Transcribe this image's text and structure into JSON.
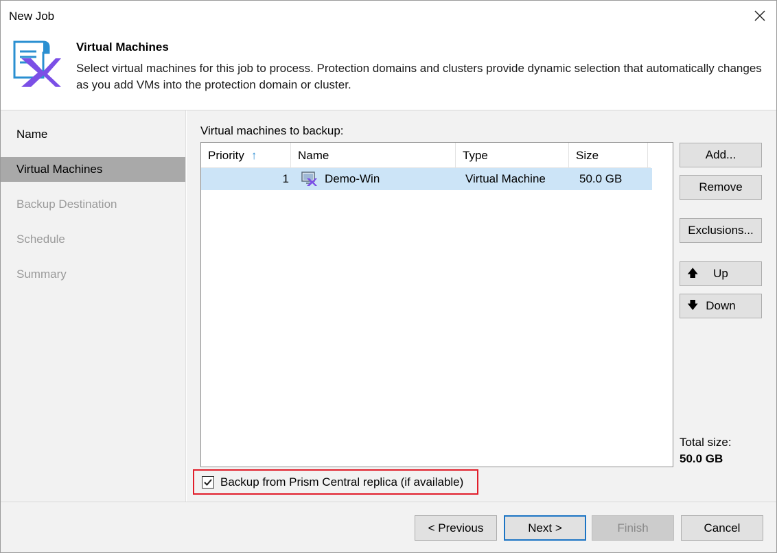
{
  "window": {
    "title": "New Job"
  },
  "header": {
    "title": "Virtual Machines",
    "description": "Select virtual machines for this job to process. Protection domains and clusters provide dynamic selection that automatically changes as you add VMs into the protection domain or cluster."
  },
  "sidebar": {
    "items": [
      {
        "label": "Name",
        "state": "done"
      },
      {
        "label": "Virtual Machines",
        "state": "active"
      },
      {
        "label": "Backup Destination",
        "state": "pending"
      },
      {
        "label": "Schedule",
        "state": "pending"
      },
      {
        "label": "Summary",
        "state": "pending"
      }
    ]
  },
  "main": {
    "list_label": "Virtual machines to backup:",
    "columns": [
      "Priority",
      "Name",
      "Type",
      "Size"
    ],
    "sort_icon": "arrow-up-icon",
    "rows": [
      {
        "priority": "1",
        "name": "Demo-Win",
        "type": "Virtual Machine",
        "size": "50.0 GB",
        "icon": "virtual-machine-icon",
        "selected": true
      }
    ],
    "buttons": {
      "add": "Add...",
      "remove": "Remove",
      "exclusions": "Exclusions...",
      "up": "Up",
      "down": "Down"
    },
    "total_label": "Total size:",
    "total_value": "50.0 GB",
    "replica_checkbox": {
      "label": "Backup from Prism Central replica (if available)",
      "checked": true
    }
  },
  "footer": {
    "previous": "< Previous",
    "next": "Next >",
    "finish": "Finish",
    "cancel": "Cancel"
  },
  "colors": {
    "accent": "#1b74c4",
    "selection": "#cce4f7",
    "highlight_border": "#e11d2a",
    "logo_purple": "#7b4fe6",
    "logo_blue": "#2a8fd1"
  }
}
